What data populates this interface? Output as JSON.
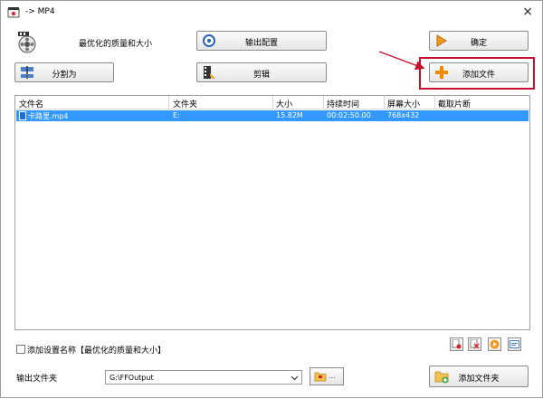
{
  "window": {
    "title": "-> MP4",
    "close_glyph": "×"
  },
  "profile": {
    "label": "最优化的质量和大小",
    "icon": "film-reel-icon"
  },
  "buttons": {
    "output_config": "输出配置",
    "confirm": "确定",
    "split": "分割为",
    "edit": "剪辑",
    "add_file": "添加文件",
    "add_folder": "添加文件夹"
  },
  "file_list": {
    "columns": [
      "文件名",
      "文件夹",
      "大小",
      "持续时间",
      "屏幕大小",
      "截取片断"
    ],
    "rows": [
      {
        "name": "卡路里.mp4",
        "folder": "E:",
        "size": "15.82M",
        "duration": "00:02:50.00",
        "screen": "768x432",
        "clip": ""
      }
    ]
  },
  "options": {
    "add_setting_name": "添加设置名称【最优化的质量和大小】",
    "checked": false
  },
  "output": {
    "label": "输出文件夹",
    "path": "G:\\FFOutput",
    "browse_dots": "..."
  },
  "colors": {
    "selection": "#3399ff",
    "highlight_box": "#c8102e",
    "arrow": "#c8102e"
  }
}
